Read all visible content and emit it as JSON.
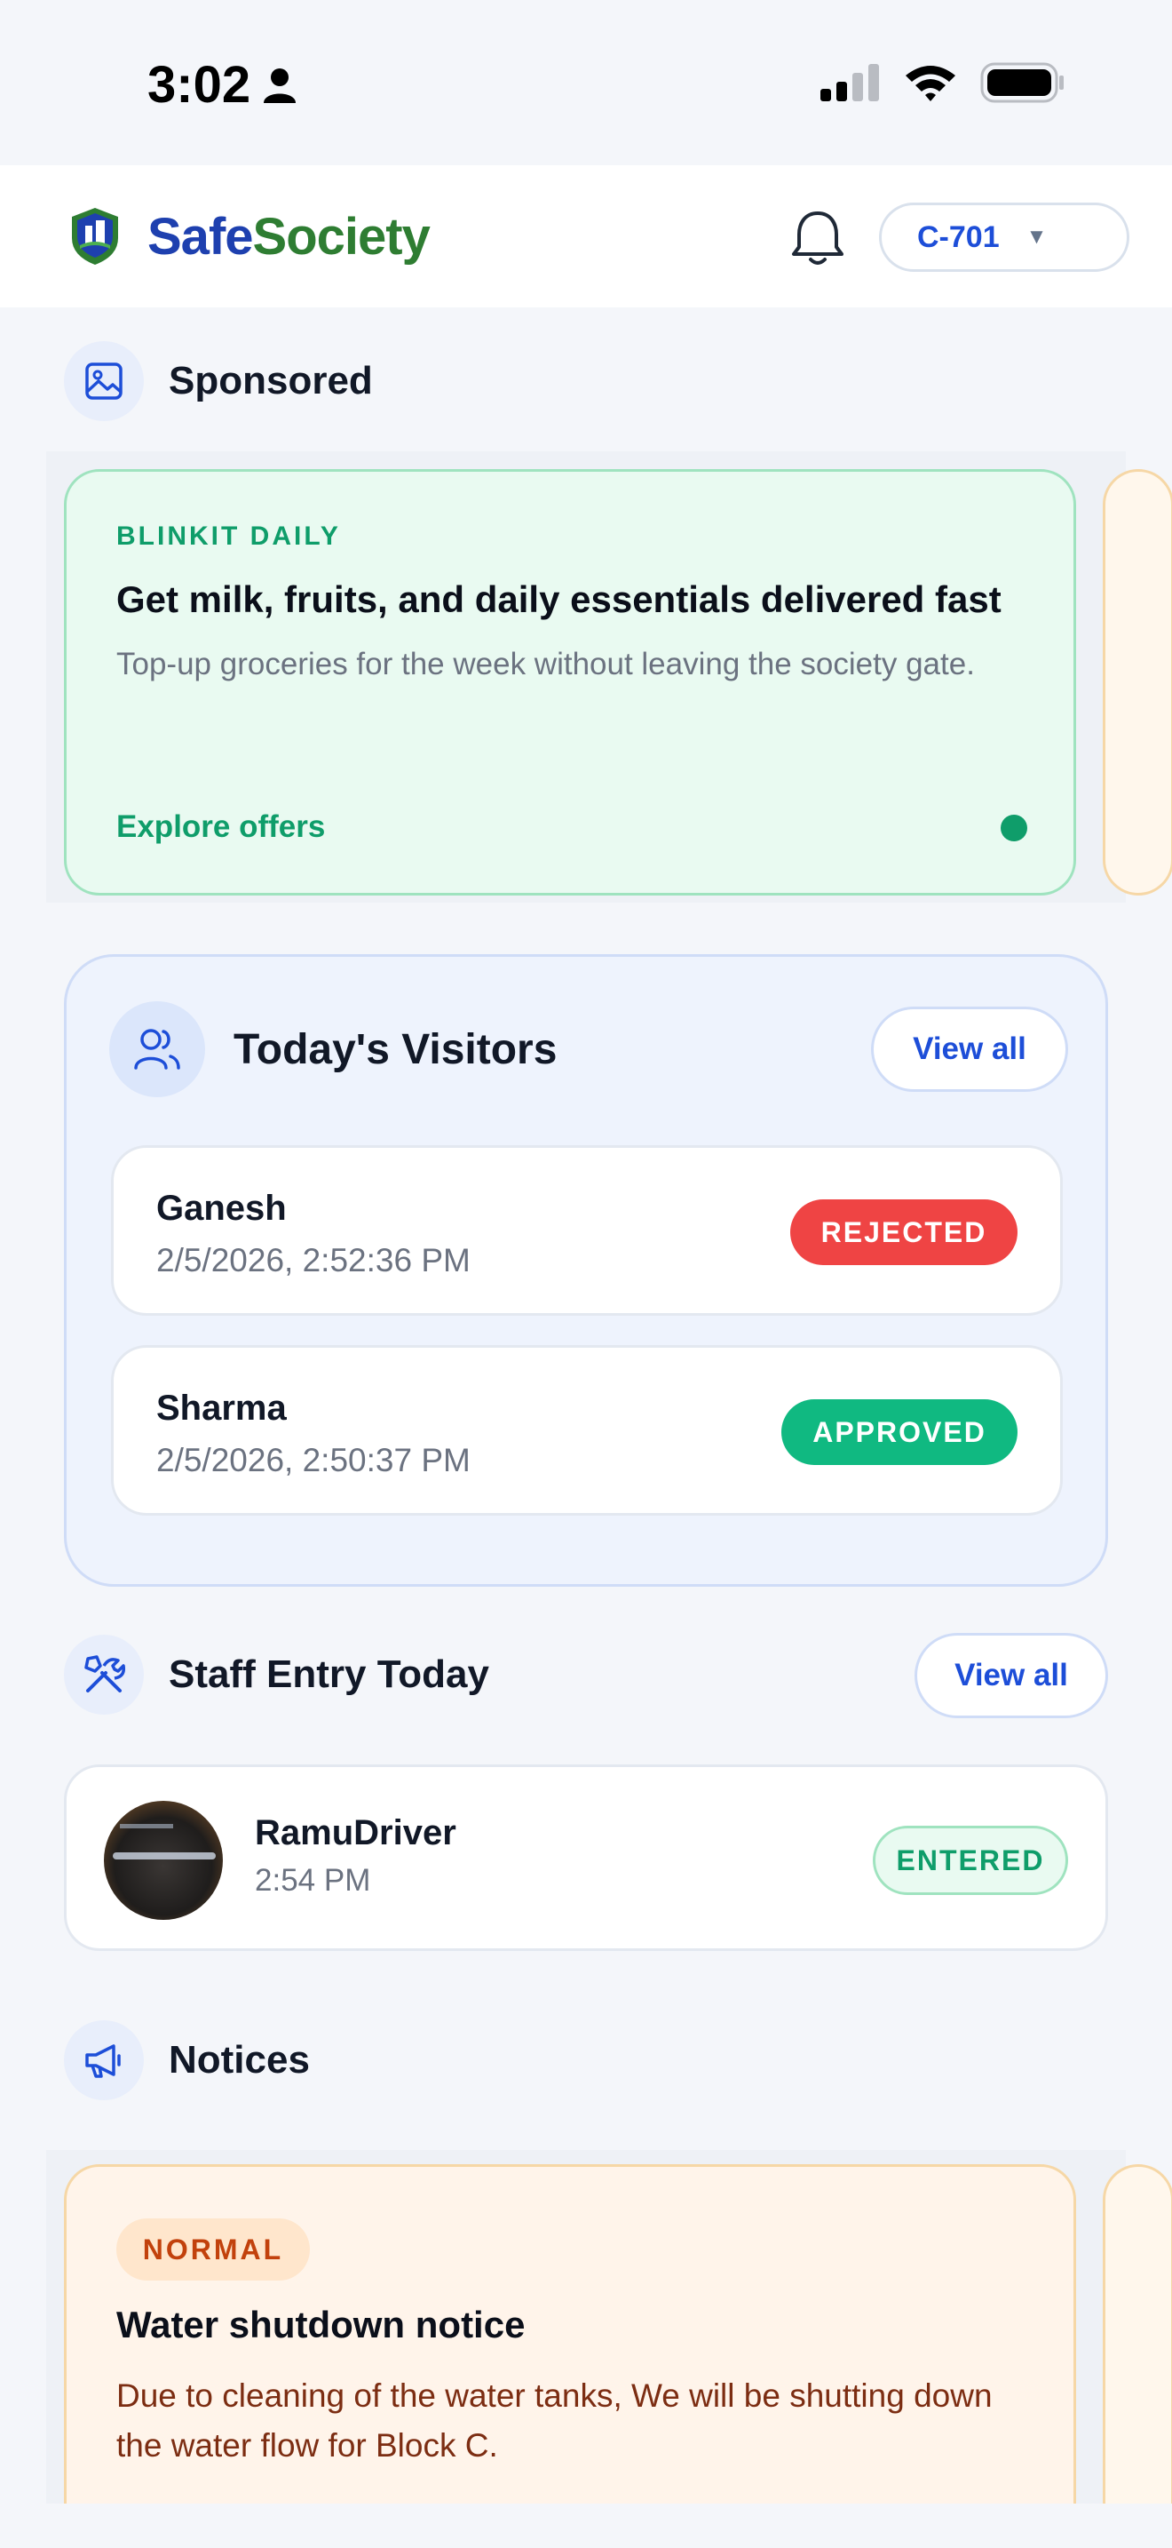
{
  "status_bar": {
    "time": "3:02"
  },
  "header": {
    "brand_part1": "Safe",
    "brand_part2": "Society",
    "unit": "C-701"
  },
  "sponsored": {
    "title": "Sponsored",
    "promo": {
      "tag": "BLINKIT DAILY",
      "headline": "Get milk, fruits, and daily essentials delivered fast",
      "description": "Top-up groceries for the week without leaving the society gate.",
      "cta": "Explore offers"
    }
  },
  "visitors": {
    "title": "Today's Visitors",
    "view_all": "View all",
    "items": [
      {
        "name": "Ganesh",
        "time": "2/5/2026, 2:52:36 PM",
        "status": "REJECTED"
      },
      {
        "name": "Sharma",
        "time": "2/5/2026, 2:50:37 PM",
        "status": "APPROVED"
      }
    ]
  },
  "staff": {
    "title": "Staff Entry Today",
    "view_all": "View all",
    "items": [
      {
        "name": "RamuDriver",
        "time": "2:54 PM",
        "status": "ENTERED"
      }
    ]
  },
  "notices": {
    "title": "Notices",
    "items": [
      {
        "priority": "NORMAL",
        "title": "Water shutdown notice",
        "body": "Due to cleaning of the water tanks, We will be shutting down the water flow for Block C."
      }
    ]
  },
  "colors": {
    "brand_blue": "#1e40af",
    "brand_green": "#2e7d32",
    "rejected": "#ef4444",
    "approved": "#10b981",
    "promo_green": "#0f9d6a",
    "notice_orange": "#c2410c"
  }
}
